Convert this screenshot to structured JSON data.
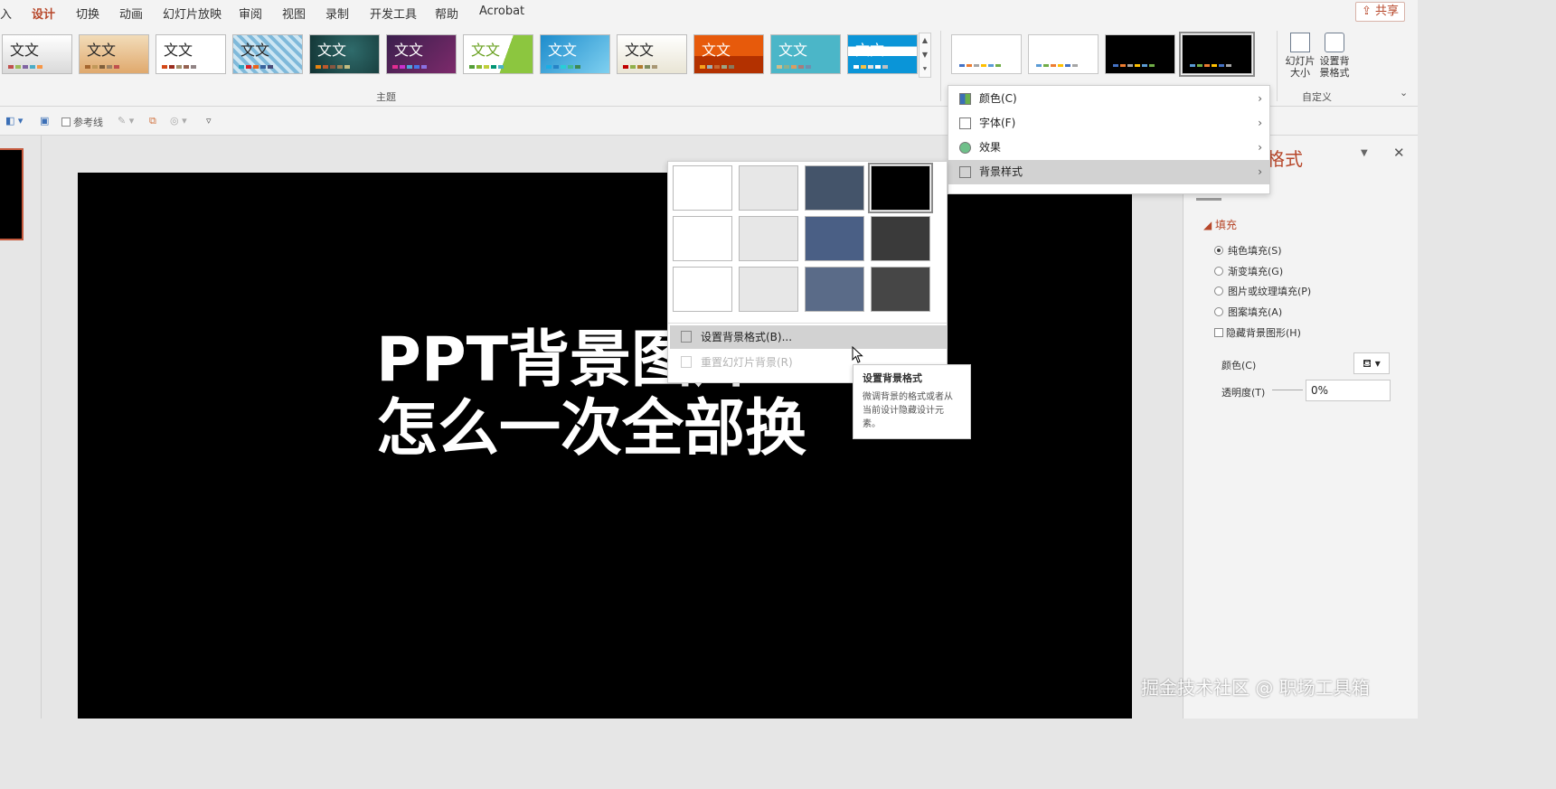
{
  "ribbon": {
    "tabs": [
      "入",
      "设计",
      "切换",
      "动画",
      "幻灯片放映",
      "审阅",
      "视图",
      "录制",
      "开发工具",
      "帮助",
      "Acrobat"
    ],
    "active_tab": "设计",
    "share_label": "共享",
    "themes_group_label": "主题",
    "theme_glyph": "文文",
    "customize_group_label": "自定义",
    "slide_size_label": "幻灯片大小",
    "format_bg_label": "设置背景格式"
  },
  "quick_access": {
    "guides_label": "参考线"
  },
  "slide": {
    "title": "PPT背景图片\n怎么一次全部换"
  },
  "variant_menu": {
    "items": [
      {
        "label": "颜色(C)"
      },
      {
        "label": "字体(F)"
      },
      {
        "label": "效果"
      },
      {
        "label": "背景样式"
      }
    ]
  },
  "bg_menu": {
    "swatch_colors": [
      "#ffffff",
      "#e7e7e7",
      "#44546a",
      "#000000",
      "#ffffff",
      "#e7e7e7",
      "#4a5f85",
      "#3a3a3a",
      "#ffffff",
      "#e7e7e7",
      "#5a6b88",
      "#464646"
    ],
    "selected_index": 3,
    "format_label": "设置背景格式(B)...",
    "reset_label": "重置幻灯片背景(R)"
  },
  "tooltip": {
    "title": "设置背景格式",
    "body": "微调背景的格式或者从当前设计隐藏设计元素。"
  },
  "format_pane": {
    "title": "格式",
    "fill_heading": "填充",
    "options": [
      "纯色填充(S)",
      "渐变填充(G)",
      "图片或纹理填充(P)",
      "图案填充(A)"
    ],
    "selected_option": "纯色填充(S)",
    "hide_bg_graphics": "隐藏背景图形(H)",
    "color_label": "颜色(C)",
    "transparency_label": "透明度(T)",
    "transparency_value": "0%"
  },
  "watermark": "掘金技术社区 @ 职场工具箱"
}
